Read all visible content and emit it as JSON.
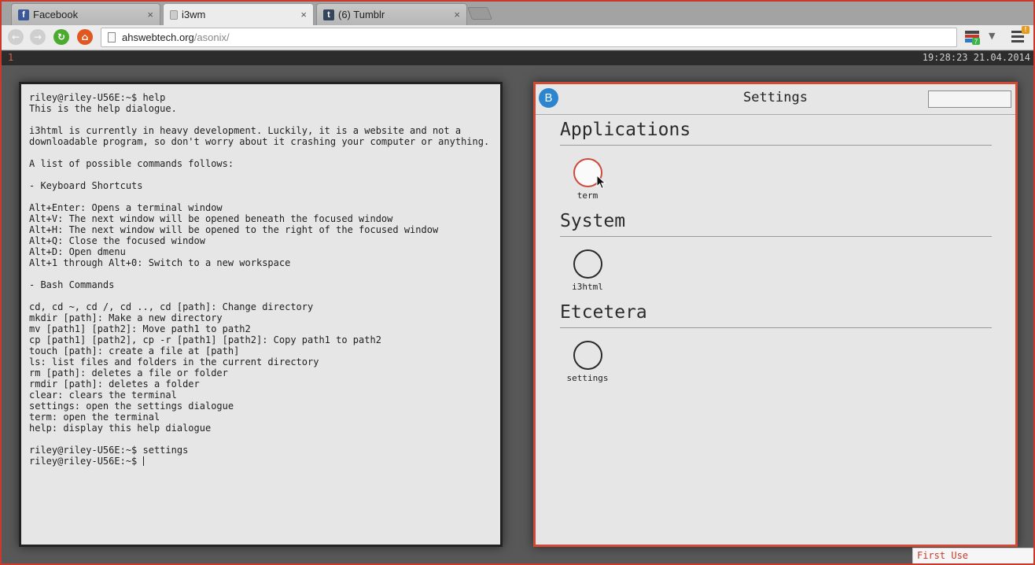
{
  "browser": {
    "tabs": [
      {
        "label": "Facebook",
        "icon": "facebook-icon",
        "active": false
      },
      {
        "label": "i3wm",
        "icon": "page-icon",
        "active": true
      },
      {
        "label": "(6) Tumblr",
        "icon": "tumblr-icon",
        "active": false
      }
    ],
    "close_glyph": "×",
    "url_host": "ahswebtech.org",
    "url_path": "/asonix/",
    "extension_badge": "7",
    "menu_badge": "!"
  },
  "i3bar": {
    "workspace": "1",
    "clock": "19:28:23 21.04.2014"
  },
  "terminal": {
    "lines": [
      "riley@riley-U56E:~$ help",
      "This is the help dialogue.",
      "",
      "i3html is currently in heavy development. Luckily, it is a website and not a",
      "downloadable program, so don't worry about it crashing your computer or anything.",
      "",
      "A list of possible commands follows:",
      "",
      "- Keyboard Shortcuts",
      "",
      "Alt+Enter: Opens a terminal window",
      "Alt+V: The next window will be opened beneath the focused window",
      "Alt+H: The next window will be opened to the right of the focused window",
      "Alt+Q: Close the focused window",
      "Alt+D: Open dmenu",
      "Alt+1 through Alt+0: Switch to a new workspace",
      "",
      "- Bash Commands",
      "",
      "cd, cd ~, cd /, cd .., cd [path]: Change directory",
      "mkdir [path]: Make a new directory",
      "mv [path1] [path2]: Move path1 to path2",
      "cp [path1] [path2], cp -r [path1] [path2]: Copy path1 to path2",
      "touch [path]: create a file at [path]",
      "ls: list files and folders in the current directory",
      "rm [path]: deletes a file or folder",
      "rmdir [path]: deletes a folder",
      "clear: clears the terminal",
      "settings: open the settings dialogue",
      "term: open the terminal",
      "help: display this help dialogue",
      "",
      "riley@riley-U56E:~$ settings"
    ],
    "prompt": "riley@riley-U56E:~$ "
  },
  "settings": {
    "logo_letter": "B",
    "title": "Settings",
    "search_value": "",
    "sections": [
      {
        "title": "Applications",
        "apps": [
          {
            "label": "term",
            "hover": true
          }
        ]
      },
      {
        "title": "System",
        "apps": [
          {
            "label": "i3html",
            "hover": false
          }
        ]
      },
      {
        "title": "Etcetera",
        "apps": [
          {
            "label": "settings",
            "hover": false
          }
        ]
      }
    ]
  },
  "first_use": "First Use",
  "colors": {
    "accent_red": "#d04a35",
    "logo_blue": "#2b86cf",
    "terminal_bg": "#e6e6e6"
  }
}
